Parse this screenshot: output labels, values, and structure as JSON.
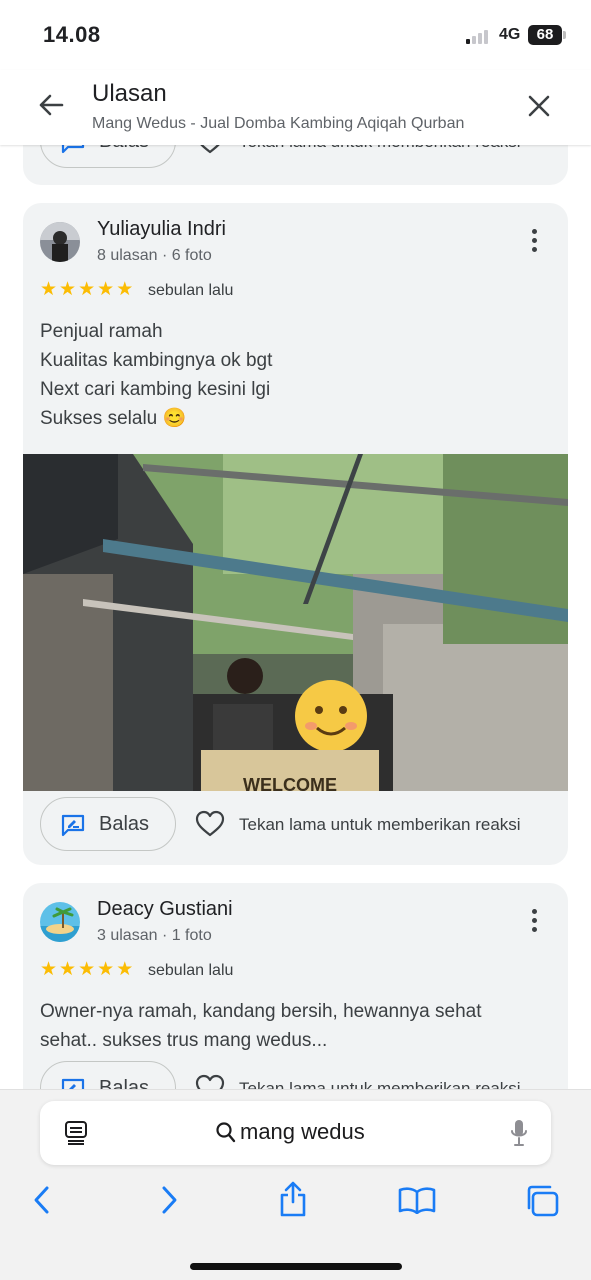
{
  "status_bar": {
    "time": "14.08",
    "network": "4G",
    "battery": "68"
  },
  "header": {
    "title": "Ulasan",
    "subtitle": "Mang Wedus - Jual Domba Kambing Aqiqah Qurban"
  },
  "reviews": [
    {
      "reply_label": "Balas",
      "react_label": "Tekan lama untuk memberikan reaksi"
    },
    {
      "reviewer": "Yuliayulia Indri",
      "meta": "8 ulasan · 6 foto",
      "rating": 5,
      "when": "sebulan lalu",
      "lines": [
        "Penjual ramah",
        "Kualitas kambingnya ok bgt",
        "Next cari kambing kesini lgi",
        "Sukses selalu 😊"
      ],
      "photo_sign_text": "WELCOME",
      "reply_label": "Balas",
      "react_label": "Tekan lama untuk memberikan reaksi"
    },
    {
      "reviewer": "Deacy Gustiani",
      "meta": "3 ulasan · 1 foto",
      "rating": 5,
      "when": "sebulan lalu",
      "lines": [
        "Owner-nya ramah, kandang bersih, hewannya sehat",
        "sehat.. sukses trus mang wedus..."
      ],
      "reply_label": "Balas",
      "react_label": "Tekan lama untuk memberikan reaksi"
    }
  ],
  "browser": {
    "search_text": "mang wedus"
  },
  "colors": {
    "star": "#fbbc04",
    "card_bg": "#f1f3f4",
    "link_blue": "#1a73e8",
    "ios_blue": "#1a7cf5"
  }
}
